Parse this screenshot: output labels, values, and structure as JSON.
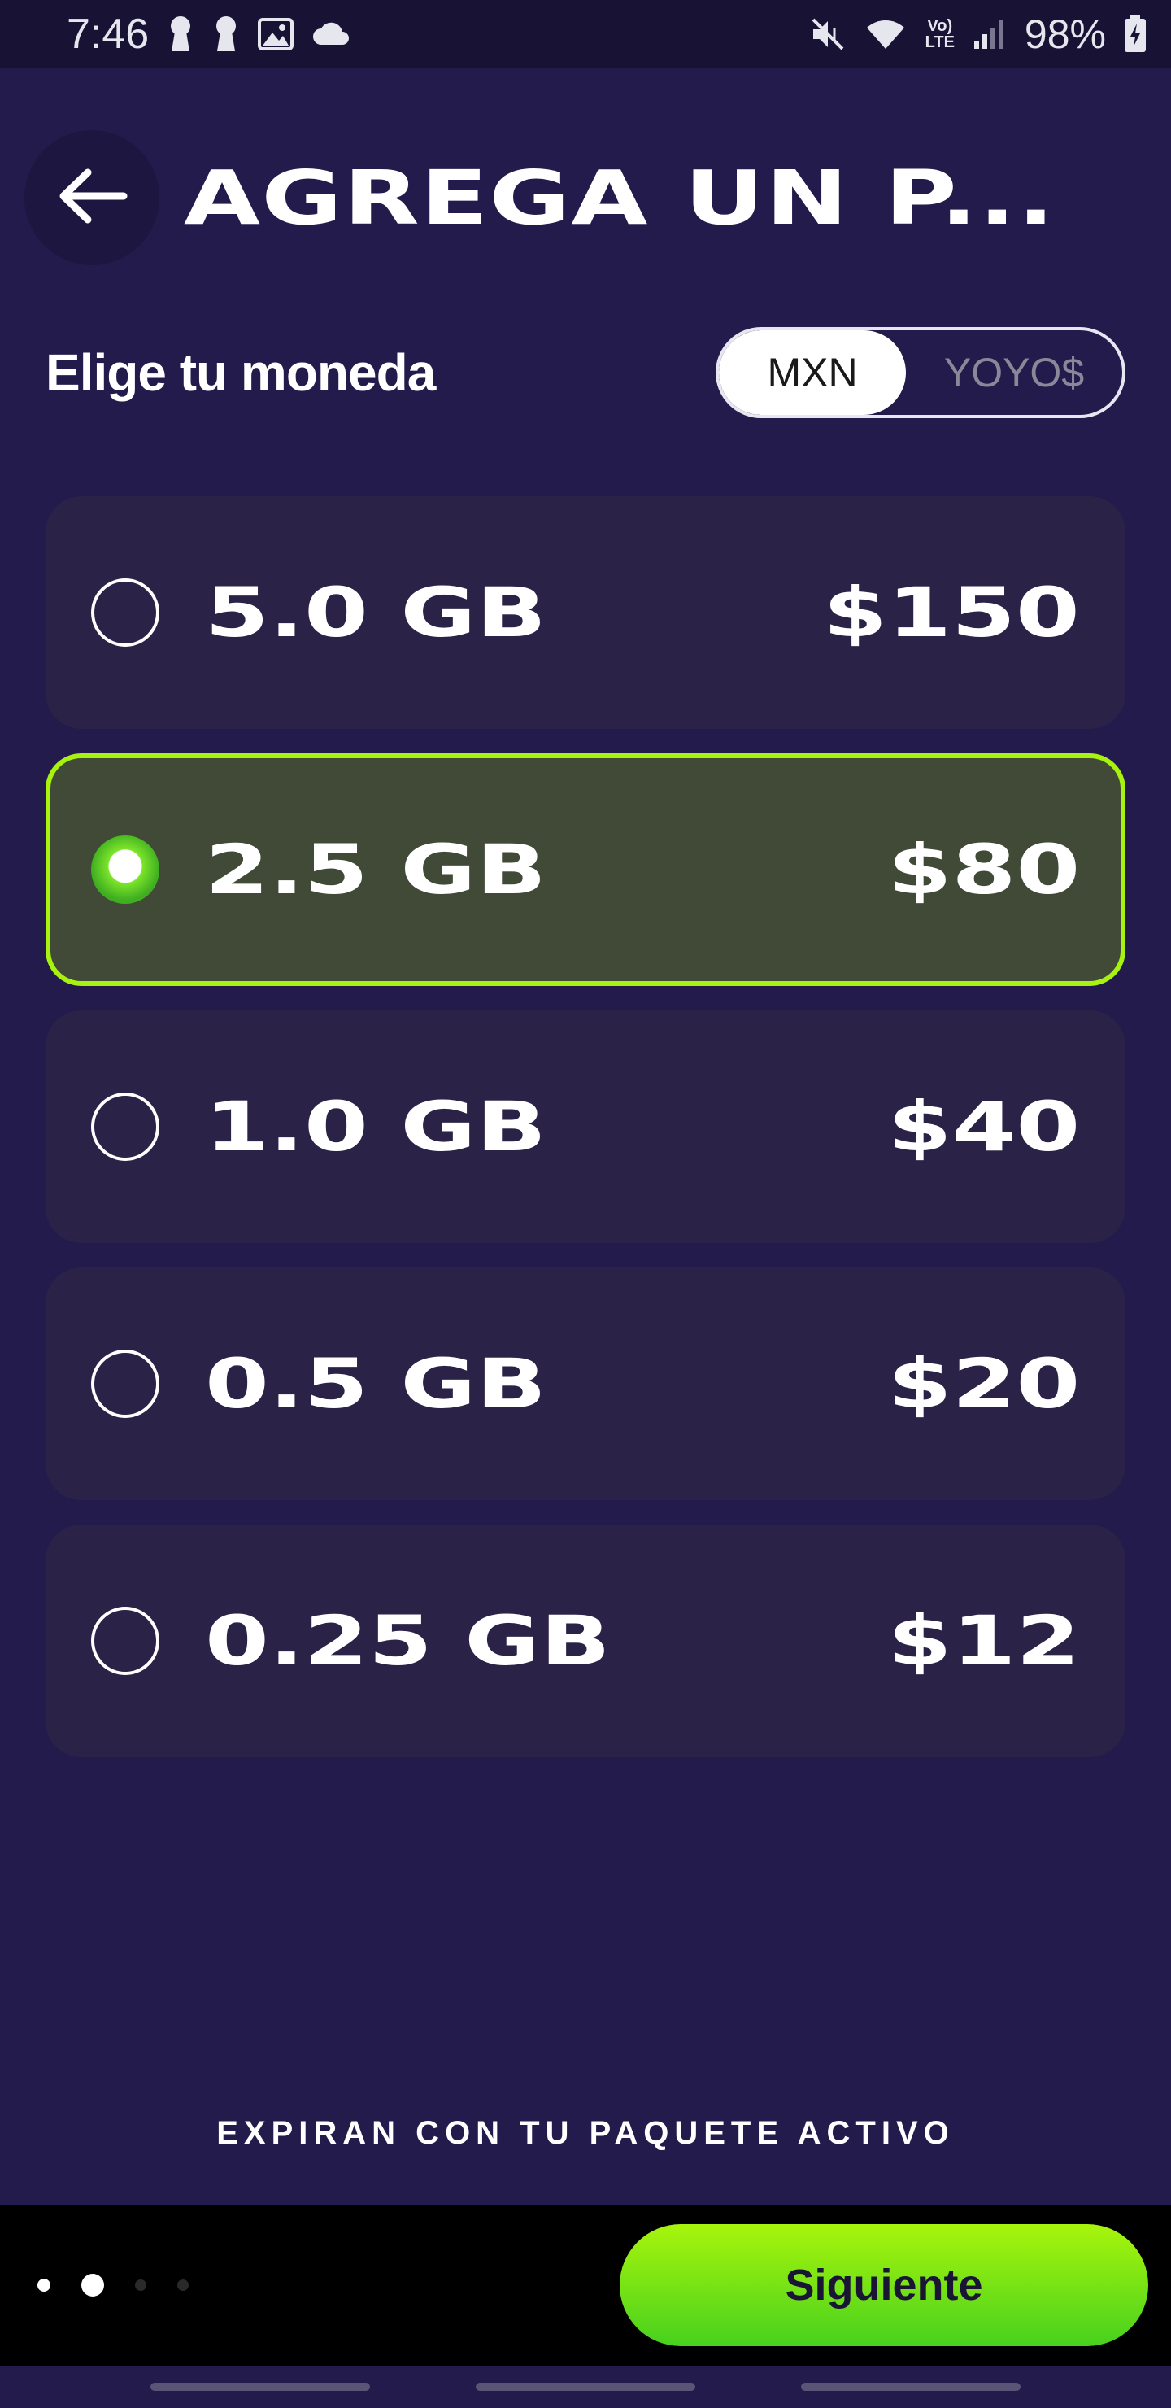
{
  "status_bar": {
    "time": "7:46",
    "battery": "98%",
    "lte": "Vo)\nLTE"
  },
  "header": {
    "title": "AGREGA UN P..."
  },
  "currency": {
    "label": "Elige tu moneda",
    "options": [
      "MXN",
      "YOYO$"
    ],
    "selected": "MXN"
  },
  "plans": [
    {
      "size": "5.0 GB",
      "price": "$150",
      "selected": false
    },
    {
      "size": "2.5 GB",
      "price": "$80",
      "selected": true
    },
    {
      "size": "1.0 GB",
      "price": "$40",
      "selected": false
    },
    {
      "size": "0.5 GB",
      "price": "$20",
      "selected": false
    },
    {
      "size": "0.25 GB",
      "price": "$12",
      "selected": false
    }
  ],
  "footer": {
    "note": "EXPIRAN CON TU PAQUETE ACTIVO",
    "next_label": "Siguiente",
    "current_page": 2,
    "total_pages": 4
  },
  "colors": {
    "background": "#231b4b",
    "accent": "#a7f20f",
    "selected_card": "#404a37",
    "card": "#2a2247"
  }
}
